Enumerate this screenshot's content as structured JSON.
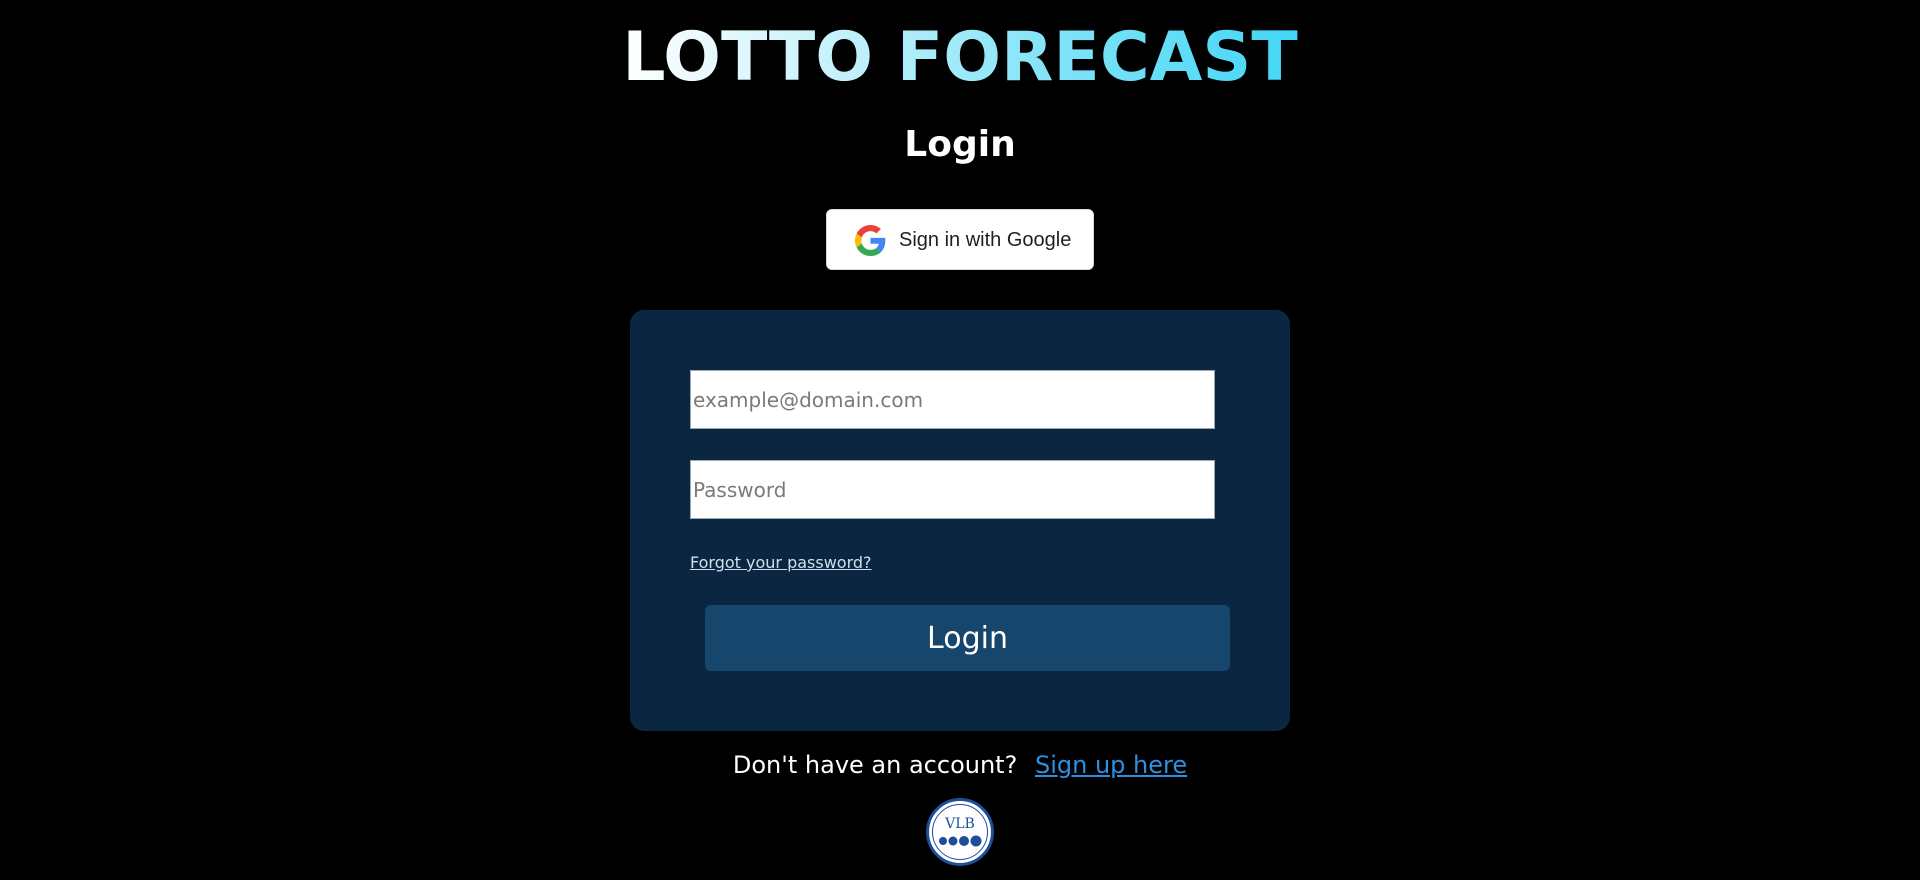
{
  "header": {
    "brand_title": "LOTTO FORECAST",
    "page_heading": "Login"
  },
  "google_signin": {
    "label": "Sign in with Google",
    "icon": "google-g-icon"
  },
  "form": {
    "email_placeholder": "example@domain.com",
    "email_value": "",
    "password_placeholder": "Password",
    "password_value": "",
    "forgot_link": "Forgot your password?",
    "submit_label": "Login"
  },
  "signup": {
    "prompt": "Don't have an account?",
    "link": "Sign up here"
  },
  "footer_logo": {
    "text": "VLB"
  },
  "colors": {
    "background": "#000000",
    "card": "#0b2640",
    "login_button": "#16466b",
    "title_gradient_end": "#43d6f5",
    "link": "#2f8fe0"
  }
}
